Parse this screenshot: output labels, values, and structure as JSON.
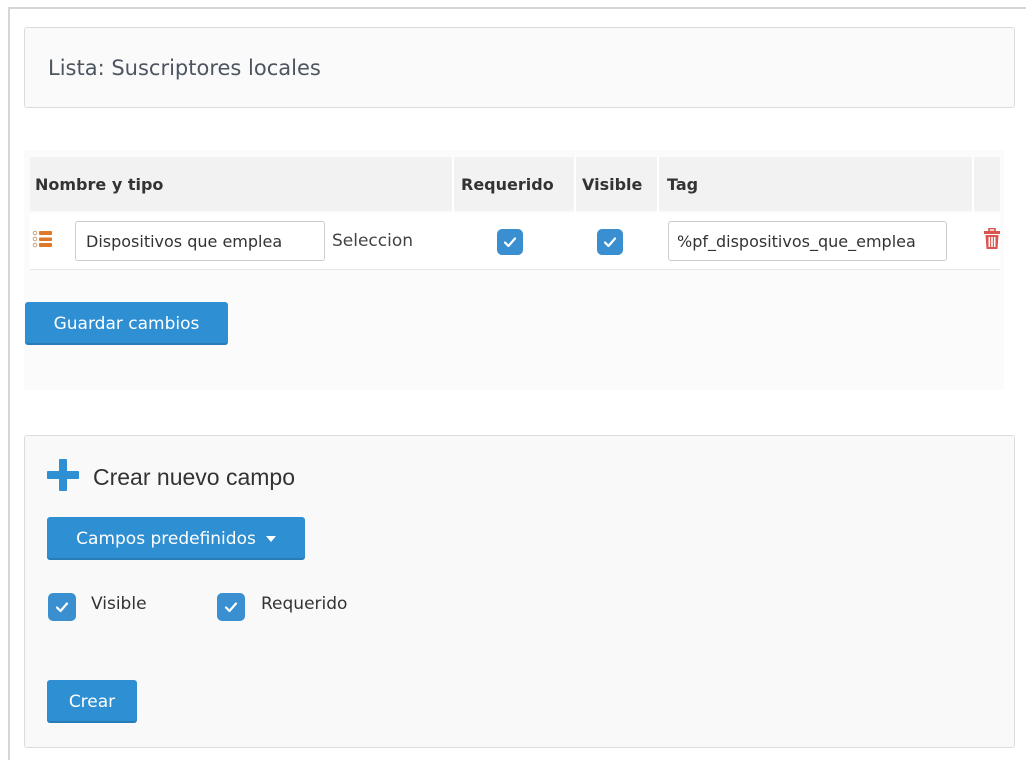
{
  "list": {
    "title": "Lista: Suscriptores locales"
  },
  "fields_table": {
    "headers": {
      "name_type": "Nombre y tipo",
      "required": "Requerido",
      "visible": "Visible",
      "tag": "Tag"
    },
    "rows": [
      {
        "name": "Dispositivos que emplea",
        "type": "Seleccion",
        "required": true,
        "visible": true,
        "tag": "%pf_dispositivos_que_emplea"
      }
    ]
  },
  "save_label": "Guardar cambios",
  "new_field": {
    "title": "Crear nuevo campo",
    "predefined_label": "Campos predefinidos",
    "visible_label": "Visible",
    "visible_checked": true,
    "required_label": "Requerido",
    "required_checked": true,
    "create_label": "Crear"
  },
  "colors": {
    "accent": "#2e8fd3",
    "checkbox": "#3a8fd0",
    "delete": "#d9534f",
    "handle": "#e0782c"
  },
  "icons": {
    "drag": "drag-handle-icon",
    "delete": "trash-icon",
    "add": "plus-icon",
    "dropdown": "caret-down-icon",
    "check": "check-icon"
  }
}
